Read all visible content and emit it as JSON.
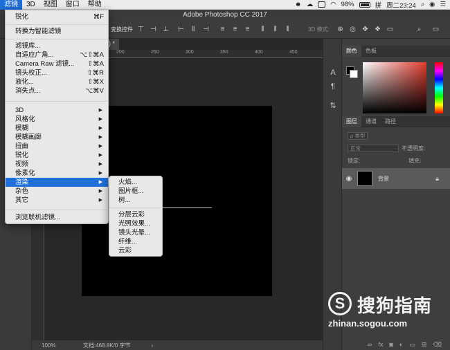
{
  "menubar": {
    "items": [
      "滤镜",
      "3D",
      "视图",
      "窗口",
      "帮助"
    ],
    "active_index": 0,
    "status": {
      "battery": "98%",
      "clock": "周二23:24"
    }
  },
  "app": {
    "title": "Adobe Photoshop CC 2017",
    "options_label": "变换控件",
    "mode_3d_label": "3D 模式:"
  },
  "document": {
    "tab_label": "0) *",
    "ruler_ticks": [
      "100",
      "150",
      "200",
      "250",
      "300",
      "350",
      "400",
      "450",
      "500"
    ],
    "zoom": "100%",
    "doc_info": "文档:468.8K/0 字节",
    "status_arrow": "›"
  },
  "filter_menu": {
    "items": [
      {
        "label": "锐化",
        "shortcut": "⌘F"
      },
      {
        "label": "转换为智能滤镜"
      },
      {
        "label": "滤镜库..."
      },
      {
        "label": "自适应广角...",
        "shortcut": "⌥⇧⌘A"
      },
      {
        "label": "Camera Raw 滤镜...",
        "shortcut": "⇧⌘A"
      },
      {
        "label": "镜头校正...",
        "shortcut": "⇧⌘R"
      },
      {
        "label": "液化...",
        "shortcut": "⇧⌘X"
      },
      {
        "label": "消失点...",
        "shortcut": "⌥⌘V"
      },
      {
        "label": "3D"
      },
      {
        "label": "风格化"
      },
      {
        "label": "模糊"
      },
      {
        "label": "模糊画廊"
      },
      {
        "label": "扭曲"
      },
      {
        "label": "锐化"
      },
      {
        "label": "视频"
      },
      {
        "label": "像素化"
      },
      {
        "label": "渲染"
      },
      {
        "label": "杂色"
      },
      {
        "label": "其它"
      },
      {
        "label": "浏览联机滤镜..."
      }
    ],
    "submenu_arrow": "▶",
    "highlighted": "渲染"
  },
  "render_submenu": {
    "items": [
      "火焰...",
      "图片框...",
      "树...",
      "分层云彩",
      "光照效果...",
      "镜头光晕...",
      "纤维...",
      "云彩"
    ]
  },
  "color_panel": {
    "tabs": [
      "颜色",
      "色板"
    ],
    "fg_color": "#000000",
    "bg_color": "#ffffff",
    "field_hue": "#e23a2e"
  },
  "layers_panel": {
    "tabs": [
      "图层",
      "通道",
      "路径"
    ],
    "filter_label": "ρ 类型",
    "blend_mode": "正常",
    "opacity_label": "不透明度:",
    "lock_label": "锁定:",
    "fill_label": "填充:",
    "layer_name": "背景"
  },
  "watermark": {
    "name": "搜狗指南",
    "url": "zhinan.sogou.com",
    "logo_letter": "S"
  }
}
